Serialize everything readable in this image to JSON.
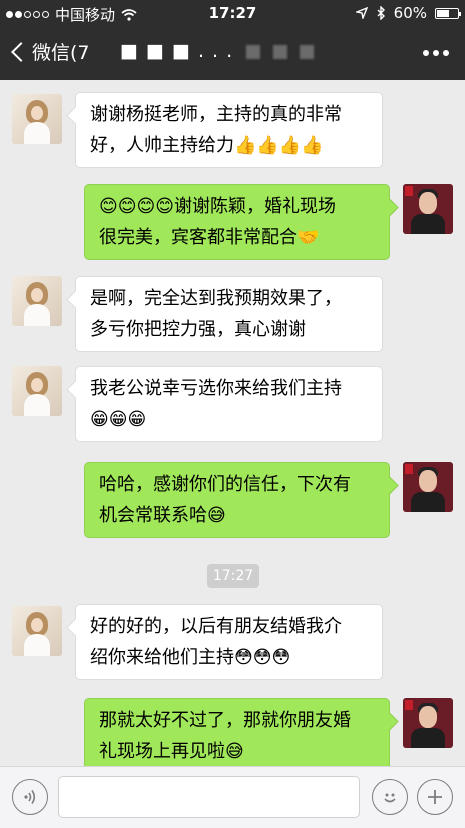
{
  "status_bar": {
    "carrier": "中国移动",
    "time": "17:27",
    "battery": "60%",
    "battery_level": 0.6,
    "signal_bars": 2,
    "wifi_icon": "wifi-icon",
    "location_icon": "location-arrow-icon",
    "bluetooth_icon": "bluetooth-icon"
  },
  "nav": {
    "back_label": "微信(7",
    "title_partial": "■ ■ ■ . . .",
    "more_icon": "more-dots-icon"
  },
  "messages": [
    {
      "side": "left",
      "lines": [
        "谢谢杨挺老师，主持的真的非常",
        "好，人帅主持给力👍👍👍👍"
      ]
    },
    {
      "side": "right",
      "lines": [
        "😊😊😊😊谢谢陈颖，婚礼现场",
        "很完美，宾客都非常配合🤝"
      ]
    },
    {
      "side": "left",
      "lines": [
        "是啊，完全达到我预期效果了，",
        "多亏你把控力强，真心谢谢"
      ]
    },
    {
      "side": "left",
      "lines": [
        "我老公说幸亏选你来给我们主持",
        "😁😁😁"
      ]
    },
    {
      "side": "right",
      "lines": [
        "哈哈，感谢你们的信任，下次有",
        "机会常联系哈😅"
      ]
    },
    {
      "side": "left",
      "lines": [
        "好的好的，以后有朋友结婚我介",
        "绍你来给他们主持😳😳😳"
      ]
    },
    {
      "side": "right",
      "lines": [
        "那就太好不过了，那就你朋友婚",
        "礼现场上再见啦😅"
      ]
    }
  ],
  "timestamp": "17:27",
  "input_bar": {
    "voice_icon": "voice-icon",
    "emoji_icon": "emoji-smile-icon",
    "plus_icon": "plus-icon"
  },
  "colors": {
    "header_bg": "#2e2e2e",
    "chat_bg": "#ebebeb",
    "bubble_right": "#a0e75a",
    "bubble_left": "#ffffff"
  }
}
